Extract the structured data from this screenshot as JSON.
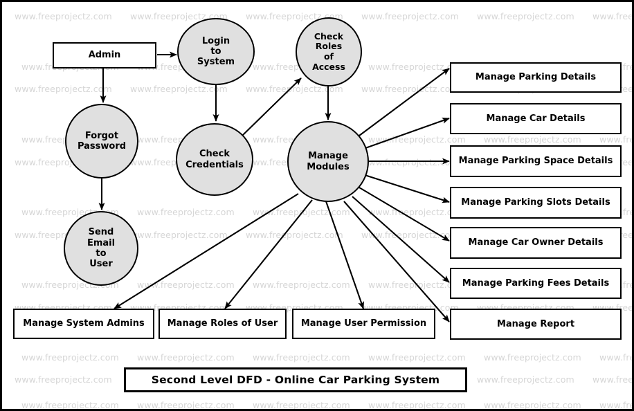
{
  "diagram": {
    "title": "Second Level DFD - Online Car Parking System",
    "watermark_text": "www.freeprojectz.com",
    "colors": {
      "process_fill": "#e0e0e0",
      "stroke": "#000000",
      "entity_fill": "#ffffff",
      "watermark": "#d6d6d6",
      "background": "#ffffff"
    }
  },
  "nodes": {
    "external_entity": {
      "label": "Admin"
    },
    "processes": [
      {
        "id": "login",
        "label": "Login\nto\nSystem",
        "lines": [
          "Login",
          "to",
          "System"
        ]
      },
      {
        "id": "check_roles",
        "label": "Check\nRoles\nof\nAccess",
        "lines": [
          "Check",
          "Roles",
          "of",
          "Access"
        ]
      },
      {
        "id": "forgot_password",
        "label": "Forgot\nPassword",
        "lines": [
          "Forgot",
          "Password"
        ]
      },
      {
        "id": "check_credentials",
        "label": "Check\nCredentials",
        "lines": [
          "Check",
          "Credentials"
        ]
      },
      {
        "id": "send_email",
        "label": "Send\nEmail\nto\nUser",
        "lines": [
          "Send",
          "Email",
          "to",
          "User"
        ]
      },
      {
        "id": "manage_modules",
        "label": "Manage\nModules",
        "lines": [
          "Manage",
          "Modules"
        ]
      }
    ],
    "right_stores": [
      {
        "id": "parking_details",
        "label": "Manage Parking Details"
      },
      {
        "id": "car_details",
        "label": "Manage Car Details"
      },
      {
        "id": "parking_space_details",
        "label": "Manage Parking Space Details"
      },
      {
        "id": "parking_slots_details",
        "label": "Manage Parking Slots Details"
      },
      {
        "id": "car_owner_details",
        "label": "Manage Car Owner Details"
      },
      {
        "id": "parking_fees_details",
        "label": "Manage Parking Fees Details"
      },
      {
        "id": "report",
        "label": "Manage Report"
      }
    ],
    "bottom_stores": [
      {
        "id": "system_admins",
        "label": "Manage System Admins"
      },
      {
        "id": "roles_of_user",
        "label": "Manage Roles of User"
      },
      {
        "id": "user_permission",
        "label": "Manage User Permission"
      }
    ]
  },
  "flows": [
    {
      "from": "Admin",
      "to": "Login to System"
    },
    {
      "from": "Admin",
      "to": "Forgot Password"
    },
    {
      "from": "Forgot Password",
      "to": "Send Email to User"
    },
    {
      "from": "Login to System",
      "to": "Check Credentials"
    },
    {
      "from": "Check Credentials",
      "to": "Check Roles of Access"
    },
    {
      "from": "Check Roles of Access",
      "to": "Manage Modules"
    },
    {
      "from": "Manage Modules",
      "to": "Manage Parking Details"
    },
    {
      "from": "Manage Modules",
      "to": "Manage Car Details"
    },
    {
      "from": "Manage Modules",
      "to": "Manage Parking Space Details"
    },
    {
      "from": "Manage Modules",
      "to": "Manage Parking Slots Details"
    },
    {
      "from": "Manage Modules",
      "to": "Manage Car Owner Details"
    },
    {
      "from": "Manage Modules",
      "to": "Manage Parking Fees Details"
    },
    {
      "from": "Manage Modules",
      "to": "Manage Report"
    },
    {
      "from": "Manage Modules",
      "to": "Manage System Admins"
    },
    {
      "from": "Manage Modules",
      "to": "Manage Roles of User"
    },
    {
      "from": "Manage Modules",
      "to": "Manage User Permission"
    }
  ]
}
